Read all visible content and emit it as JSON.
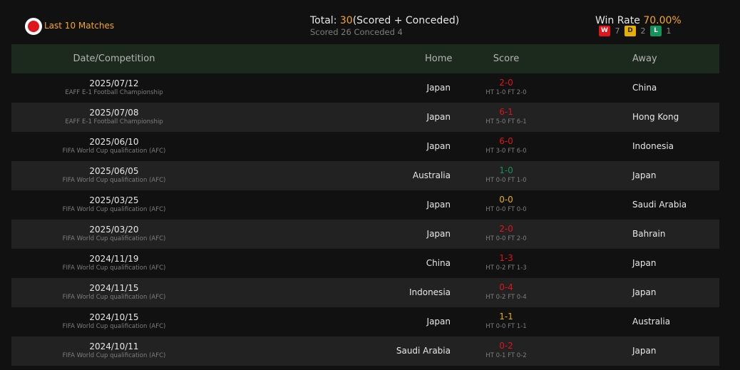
{
  "header": {
    "last10_label": "Last 10 Matches",
    "total_prefix": "Total: ",
    "total_value": "30",
    "total_suffix": "(Scored + Conceded)",
    "subtotal": "Scored 26 Conceded 4",
    "winrate_label": "Win Rate ",
    "winrate_value": "70.00%",
    "record": {
      "w_label": "W",
      "w": "7",
      "d_label": "D",
      "d": "2",
      "l_label": "L",
      "l": "1"
    }
  },
  "columns": {
    "date": "Date/Competition",
    "home": "Home",
    "score": "Score",
    "away": "Away"
  },
  "colors": {
    "win": "#e0141b",
    "draw": "#e6b000",
    "loss": "#14935b",
    "accent": "#f5a623"
  },
  "matches": [
    {
      "date": "2025/07/12",
      "competition": "EAFF E-1 Football Championship",
      "home": "Japan",
      "score": "2-0",
      "ht": "HT 1-0 FT 2-0",
      "away": "China",
      "result": "win"
    },
    {
      "date": "2025/07/08",
      "competition": "EAFF E-1 Football Championship",
      "home": "Japan",
      "score": "6-1",
      "ht": "HT 5-0 FT 6-1",
      "away": "Hong Kong",
      "result": "win"
    },
    {
      "date": "2025/06/10",
      "competition": "FIFA World Cup qualification (AFC)",
      "home": "Japan",
      "score": "6-0",
      "ht": "HT 3-0 FT 6-0",
      "away": "Indonesia",
      "result": "win"
    },
    {
      "date": "2025/06/05",
      "competition": "FIFA World Cup qualification (AFC)",
      "home": "Australia",
      "score": "1-0",
      "ht": "HT 0-0 FT 1-0",
      "away": "Japan",
      "result": "loss"
    },
    {
      "date": "2025/03/25",
      "competition": "FIFA World Cup qualification (AFC)",
      "home": "Japan",
      "score": "0-0",
      "ht": "HT 0-0 FT 0-0",
      "away": "Saudi Arabia",
      "result": "draw"
    },
    {
      "date": "2025/03/20",
      "competition": "FIFA World Cup qualification (AFC)",
      "home": "Japan",
      "score": "2-0",
      "ht": "HT 0-0 FT 2-0",
      "away": "Bahrain",
      "result": "win"
    },
    {
      "date": "2024/11/19",
      "competition": "FIFA World Cup qualification (AFC)",
      "home": "China",
      "score": "1-3",
      "ht": "HT 0-2 FT 1-3",
      "away": "Japan",
      "result": "win"
    },
    {
      "date": "2024/11/15",
      "competition": "FIFA World Cup qualification (AFC)",
      "home": "Indonesia",
      "score": "0-4",
      "ht": "HT 0-2 FT 0-4",
      "away": "Japan",
      "result": "win"
    },
    {
      "date": "2024/10/15",
      "competition": "FIFA World Cup qualification (AFC)",
      "home": "Japan",
      "score": "1-1",
      "ht": "HT 0-0 FT 1-1",
      "away": "Australia",
      "result": "draw"
    },
    {
      "date": "2024/10/11",
      "competition": "FIFA World Cup qualification (AFC)",
      "home": "Saudi Arabia",
      "score": "0-2",
      "ht": "HT 0-1 FT 0-2",
      "away": "Japan",
      "result": "win"
    }
  ]
}
